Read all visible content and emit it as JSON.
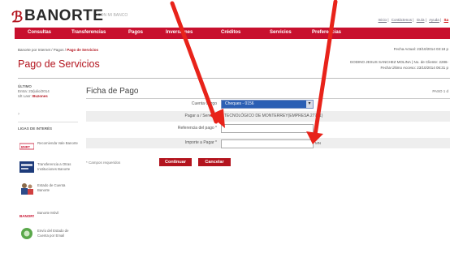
{
  "header": {
    "logo_mark": "ℬ",
    "logo_text": "BANORTE",
    "logo_tagline": "CON MI BANCO",
    "top_links": [
      "Inicio",
      "Contáctenos",
      "Guía",
      "Ayuda"
    ],
    "exit_link": "Sa"
  },
  "nav": {
    "items": [
      "Consultas",
      "Transferencias",
      "Pagos",
      "Inversiones",
      "Créditos",
      "Servicios",
      "Preferencias"
    ]
  },
  "breadcrumb": {
    "prefix": "Banorte por Internet / Pagos / ",
    "current": "Pago de Servicios"
  },
  "page": {
    "title": "Pago de Servicios",
    "date_right": "Fecha Actual: 23/10/2014 03:18 p",
    "user_line1": "GODINO JESUS SANCHEZ MOLINA | No. de Cliente: 2286-",
    "user_line2": "Fecha Último Acceso: 23/10/2014 06:31 p"
  },
  "sidebar": {
    "section_label": "ÚLTIMO",
    "date_line": "Entra: 23/julio/2014",
    "login_prefix": "Ult Lasr: ",
    "login_value": "Buzones",
    "arrow": "›",
    "heading": "LIGAS DE INTERÉS",
    "items": [
      {
        "label": "Recomienda Vale Banorte"
      },
      {
        "label": "Transferencia a Otras Instituciones Banorte"
      },
      {
        "label": "Estado de Cuenta Banorte"
      },
      {
        "label": "Banorte Móvil"
      },
      {
        "label": "Envío del Estado de Cuenta por Email"
      }
    ]
  },
  "form": {
    "title": "Ficha de Pago",
    "page_indicator": "PASO 1 d",
    "cuenta_label": "Cuenta Cargo",
    "cuenta_value": "Cheques - 0156",
    "pagar_label": "Pagar a / Servicio",
    "pagar_value": "TECNOLÓGICO DE MONTERREY(EMPRESA 27771)",
    "referencia_label": "Referencia del pago *",
    "referencia_value": "",
    "importe_label": "Importe a Pagar *",
    "importe_value": "",
    "currency": "MN",
    "required_note": "* Campos requeridos",
    "continue_label": "Continuar",
    "cancel_label": "Cancelar"
  },
  "colors": {
    "brand_red": "#c8102e",
    "select_blue": "#2b5fb4",
    "annotation_arrow": "#e8231a"
  }
}
